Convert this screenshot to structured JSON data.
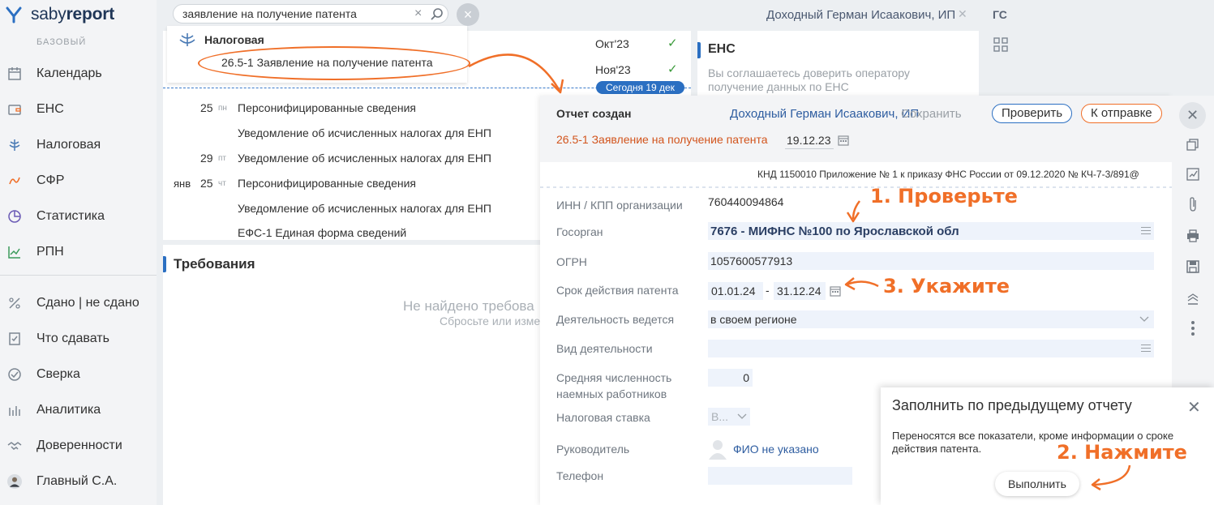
{
  "app": {
    "logo_light": "saby",
    "logo_bold": "report",
    "tariff": "БАЗОВЫЙ"
  },
  "sidebar": {
    "items": [
      {
        "label": "Календарь",
        "icon": "calendar-icon"
      },
      {
        "label": "ЕНС",
        "icon": "wallet-icon"
      },
      {
        "label": "Налоговая",
        "icon": "tax-emblem-icon"
      },
      {
        "label": "СФР",
        "icon": "sfr-icon"
      },
      {
        "label": "Статистика",
        "icon": "pie-chart-icon"
      },
      {
        "label": "РПН",
        "icon": "rpn-chart-icon"
      },
      {
        "label": "Сдано | не сдано",
        "icon": "percent-icon"
      },
      {
        "label": "Что сдавать",
        "icon": "checklist-icon"
      },
      {
        "label": "Сверка",
        "icon": "reconcile-icon"
      },
      {
        "label": "Аналитика",
        "icon": "bars-icon"
      },
      {
        "label": "Доверенности",
        "icon": "handshake-icon"
      },
      {
        "label": "Главный С.А.",
        "icon": "user-avatar"
      }
    ]
  },
  "search": {
    "value": "заявление на получение патента"
  },
  "dropdown": {
    "group": "Налоговая",
    "result": "26.5-1 Заявление на получение патента"
  },
  "topbar": {
    "user": "Доходный Герман Исаакович, ИП",
    "initials_main": "ГС"
  },
  "calendar": {
    "months": [
      {
        "label": "Окт'23",
        "check": "✓"
      },
      {
        "label": "Ноя'23",
        "check": "✓"
      }
    ],
    "today": "Сегодня 19 дек",
    "rows": [
      {
        "month": "",
        "day": "25",
        "weekday": "пн",
        "event": "Персонифицированные сведения"
      },
      {
        "month": "",
        "day": "",
        "weekday": "",
        "event": "Уведомление об исчисленных налогах для ЕНП"
      },
      {
        "month": "",
        "day": "29",
        "weekday": "пт",
        "event": "Уведомление об исчисленных налогах для ЕНП"
      },
      {
        "month": "янв",
        "day": "25",
        "weekday": "чт",
        "event": "Персонифицированные сведения"
      },
      {
        "month": "",
        "day": "",
        "weekday": "",
        "event": "Уведомление об исчисленных налогах для ЕНП"
      },
      {
        "month": "",
        "day": "",
        "weekday": "",
        "event": "ЕФС-1 Единая форма сведений"
      }
    ]
  },
  "ens": {
    "title": "ЕНС",
    "text": "Вы соглашаетесь доверить оператору получение данных по ЕНС"
  },
  "requirements": {
    "title": "Требования",
    "empty": "Не найдено требова",
    "hint": "Сбросьте или изме"
  },
  "report": {
    "status": "Отчет создан",
    "owner": "Доходный Герман Исаакович, ИП",
    "save": "Сохранить",
    "check": "Проверить",
    "send": "К отправке",
    "doc_name": "26.5-1 Заявление на получение патента",
    "date": "19.12.23",
    "knd": "КНД 1150010 Приложение № 1 к приказу ФНС России от 09.12.2020 № КЧ-7-3/891@",
    "fields": {
      "inn_label": "ИНН / КПП организации",
      "inn": "760440094864",
      "authority_label": "Госорган",
      "authority": "7676 - МИФНС №100 по Ярославской обл",
      "ogrn_label": "ОГРН",
      "ogrn": "1057600577913",
      "period_label": "Срок действия патента",
      "period_from": "01.01.24",
      "period_sep": "-",
      "period_to": "31.12.24",
      "activity_place_label": "Деятельность ведется",
      "activity_place": "в своем регионе",
      "activity_kind_label": "Вид деятельности",
      "employees_label_1": "Средняя численность",
      "employees_label_2": "наемных работников",
      "employees": "0",
      "rate_label": "Налоговая ставка",
      "rate": "В...",
      "head_label": "Руководитель",
      "head": "ФИО не указано",
      "phone_label": "Телефон"
    }
  },
  "annotations": {
    "a1": "1. Проверьте",
    "a2": "2. Нажмите",
    "a3": "3. Укажите"
  },
  "fill_dialog": {
    "title": "Заполнить по предыдущему отчету",
    "text": "Переносятся все показатели, кроме информации о сроке действия патента.",
    "button": "Выполнить"
  },
  "colors": {
    "accent_orange": "#f06f28",
    "accent_blue": "#2b6fc2",
    "link": "#2e5da0",
    "ok": "#3a9a3a"
  }
}
